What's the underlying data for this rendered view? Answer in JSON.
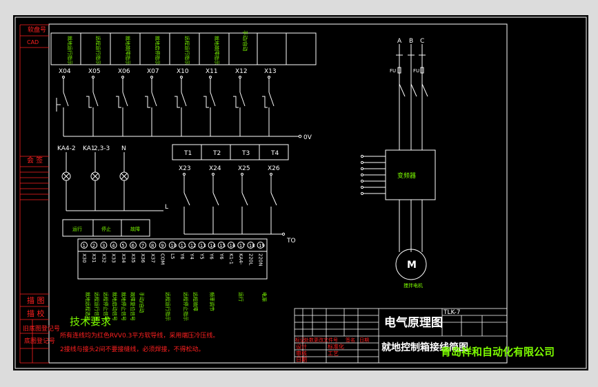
{
  "left_panel": [
    "软盘号",
    "CAD",
    "会 签",
    "描 图",
    "描 校",
    "旧底图登记号",
    "底图登记号"
  ],
  "control_modules": [
    "就地运行指示",
    "远程运行指示",
    "就地故障指示",
    "就地启停指示",
    "远程运行指示",
    "就地故障指示",
    "手动/自动"
  ],
  "input_labels": [
    "X04",
    "X05",
    "X06",
    "X07",
    "X10",
    "X11",
    "X12",
    "X13"
  ],
  "bus_label": "0V",
  "ka_labels": [
    "KA4-2",
    "KA1",
    "2,3-3",
    "N"
  ],
  "l_label": "L",
  "t_labels": [
    "T1",
    "T2",
    "T3",
    "T4"
  ],
  "x_labels": [
    "X23",
    "X24",
    "X25",
    "X26"
  ],
  "to_label": "TO",
  "terminals": [
    "X30",
    "X31",
    "X32",
    "X33",
    "X34",
    "X35",
    "X36",
    "X37",
    "COM",
    "L5",
    "Y6",
    "Y4",
    "Y5",
    "Y6",
    "Y6",
    "K1-1",
    "KA4-",
    "220L",
    "220N"
  ],
  "phases": [
    "A",
    "B",
    "C"
  ],
  "fu_labels": [
    "FU",
    "FU"
  ],
  "vfd_label": "变频器",
  "motor_label": "M",
  "motor_caption": "搅拌电机",
  "tech_title": "技术要求",
  "tech_lines": [
    "所有连线均为红色RVV0.3平方软导线，采用端压冷压线。",
    "2接线与接头2间不要接缝线，必须焊接，不得松动。"
  ],
  "title_block": {
    "title": "电气原理图",
    "code": "TLK-7",
    "subtitle": "就地控制箱接线简图",
    "company": "青岛祥和自动化有限公司",
    "rows": [
      "标记",
      "处数",
      "更改文件号",
      "签名",
      "日期",
      "设计",
      "标准化",
      "审核",
      "工艺",
      "日期"
    ]
  }
}
